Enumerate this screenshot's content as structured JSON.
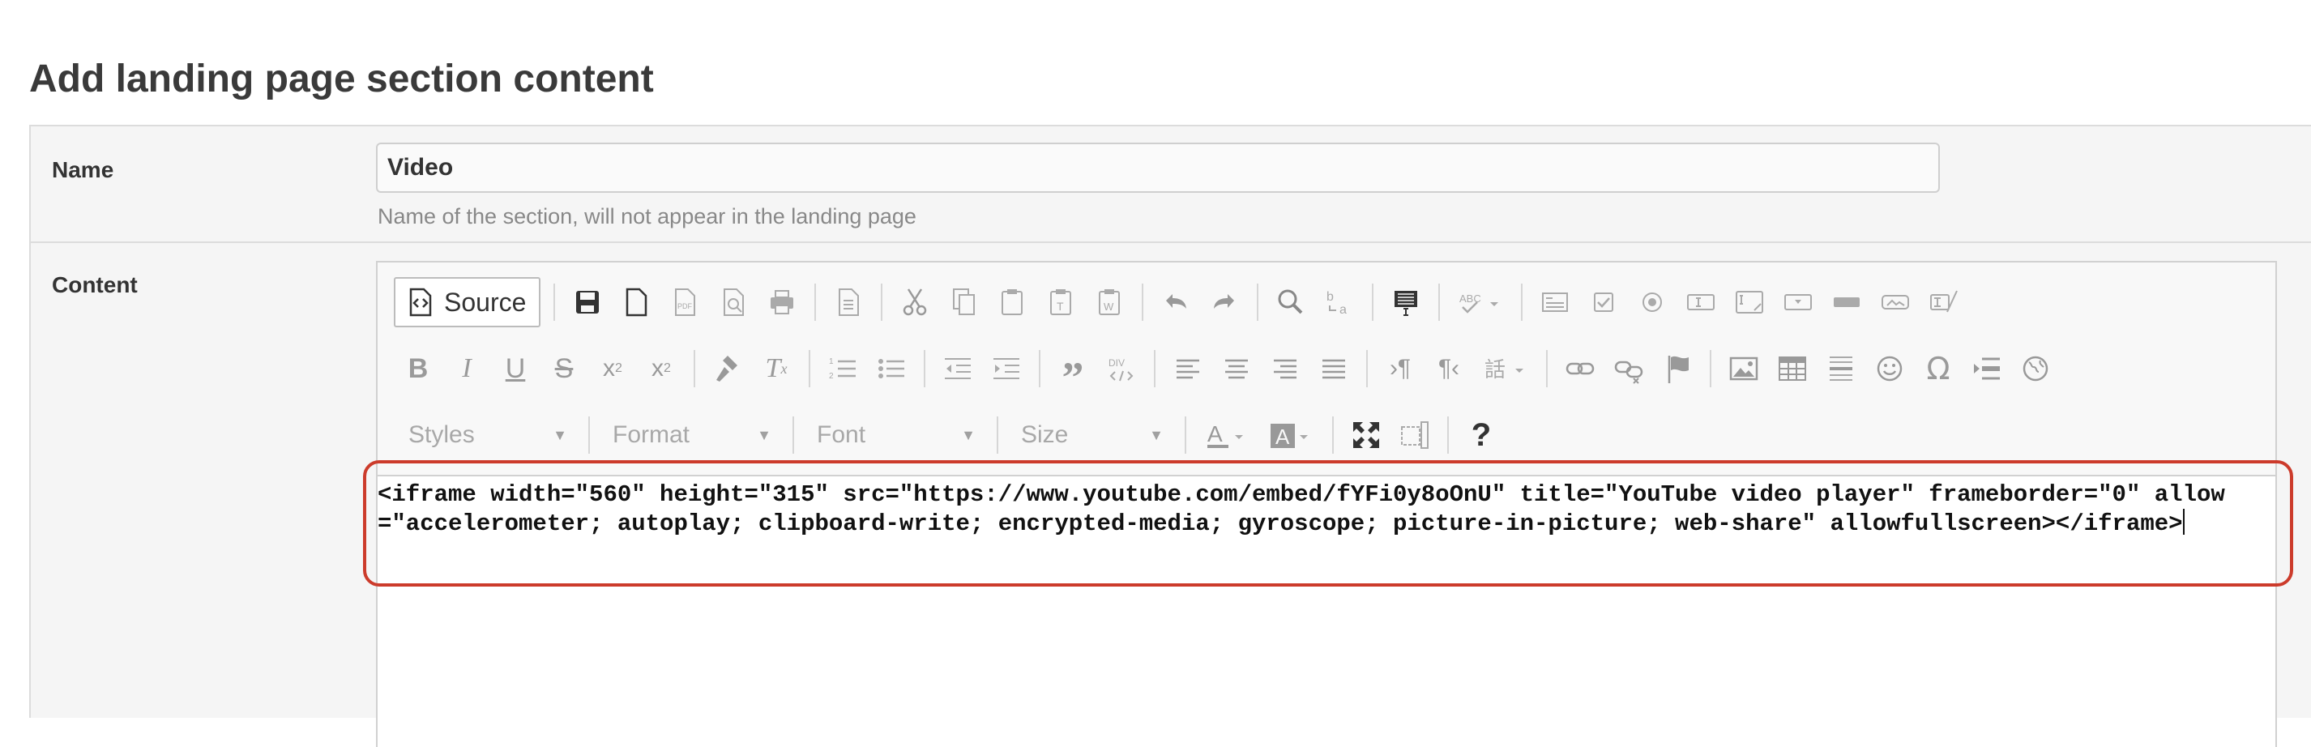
{
  "page": {
    "title": "Add landing page section content"
  },
  "form": {
    "name": {
      "label": "Name",
      "value": "Video",
      "help": "Name of the section, will not appear in the landing page"
    },
    "content": {
      "label": "Content"
    }
  },
  "editor": {
    "source_label": "Source",
    "styles_label": "Styles",
    "format_label": "Format",
    "font_label": "Font",
    "size_label": "Size",
    "help_label": "?",
    "content": "<iframe width=\"560\" height=\"315\" src=\"https://www.youtube.com/embed/fYFi0y8oOnU\" title=\"YouTube video player\" frameborder=\"0\" allow=\"accelerometer; autoplay; clipboard-write; encrypted-media; gyroscope; picture-in-picture; web-share\" allowfullscreen></iframe>"
  },
  "colors": {
    "highlight": "#cc3b2b",
    "panel_bg": "#f5f5f5",
    "toolbar_icon": "#9a9a9a"
  },
  "icons": [
    "save-icon",
    "new-page-icon",
    "export-pdf-icon",
    "preview-icon",
    "print-icon",
    "templates-icon",
    "cut-icon",
    "copy-icon",
    "paste-icon",
    "paste-text-icon",
    "paste-word-icon",
    "undo-icon",
    "redo-icon",
    "find-icon",
    "replace-icon",
    "select-all-icon",
    "spellcheck-icon",
    "form-icon",
    "checkbox-icon",
    "radio-icon",
    "text-field-icon",
    "textarea-icon",
    "select-field-icon",
    "button-icon",
    "image-button-icon",
    "hidden-field-icon",
    "bold-icon",
    "italic-icon",
    "underline-icon",
    "strike-icon",
    "subscript-icon",
    "superscript-icon",
    "copy-format-icon",
    "remove-format-icon",
    "numbered-list-icon",
    "bulleted-list-icon",
    "outdent-icon",
    "indent-icon",
    "blockquote-icon",
    "div-icon",
    "align-left-icon",
    "align-center-icon",
    "align-right-icon",
    "justify-icon",
    "ltr-icon",
    "rtl-icon",
    "language-icon",
    "link-icon",
    "unlink-icon",
    "anchor-icon",
    "image-icon",
    "table-icon",
    "horizontal-rule-icon",
    "smiley-icon",
    "special-char-icon",
    "page-break-icon",
    "iframe-icon",
    "text-color-icon",
    "bg-color-icon",
    "maximize-icon",
    "show-blocks-icon",
    "help-icon"
  ]
}
